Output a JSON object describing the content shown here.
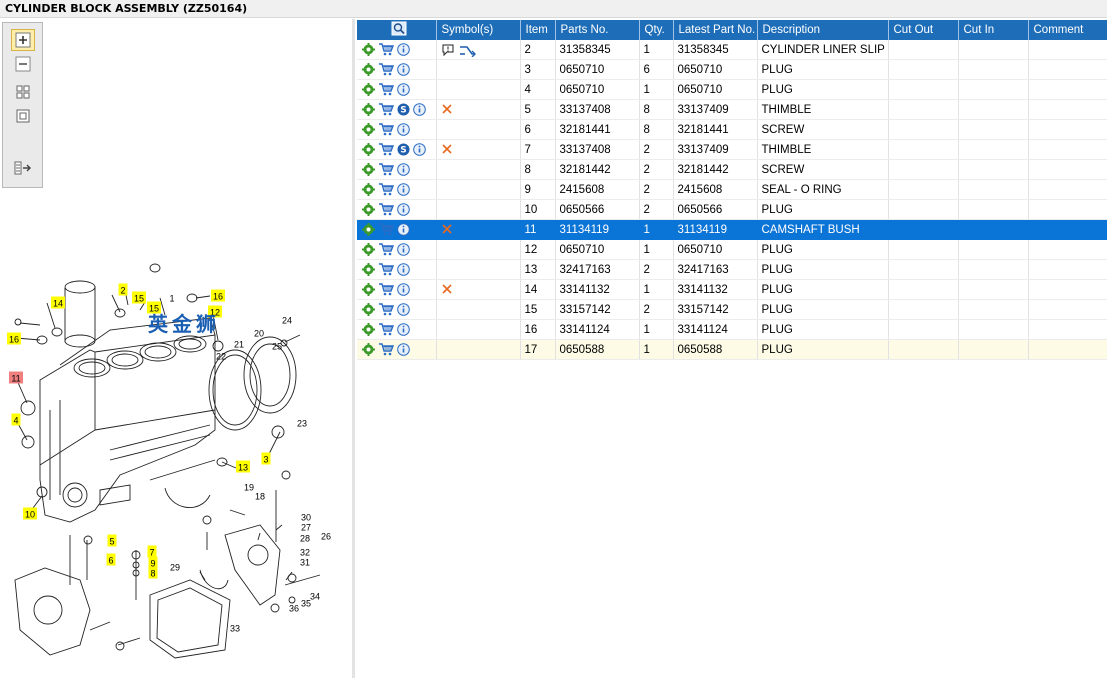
{
  "title": "CYLINDER BLOCK ASSEMBLY (ZZ50164)",
  "toolbar": {
    "items": [
      "zoom-in-icon",
      "zoom-out-icon",
      "tile-view-icon",
      "single-view-icon",
      "export-list-icon"
    ]
  },
  "columns": [
    "",
    "Symbol(s)",
    "Item",
    "Parts No.",
    "Qty.",
    "Latest Part No.",
    "Description",
    "Cut Out",
    "Cut In",
    "Comment"
  ],
  "rows": [
    {
      "item": "2",
      "parts_no": "31358345",
      "qty": "1",
      "latest": "31358345",
      "description": "CYLINDER LINER SLIP FIT",
      "icons": [
        "gear",
        "cart",
        "info"
      ],
      "symbols": [
        "comment",
        "exchange"
      ],
      "state": "normal"
    },
    {
      "item": "3",
      "parts_no": "0650710",
      "qty": "6",
      "latest": "0650710",
      "description": "PLUG",
      "icons": [
        "gear",
        "cart",
        "info"
      ],
      "symbols": [],
      "state": "normal"
    },
    {
      "item": "4",
      "parts_no": "0650710",
      "qty": "1",
      "latest": "0650710",
      "description": "PLUG",
      "icons": [
        "gear",
        "cart",
        "info"
      ],
      "symbols": [],
      "state": "normal"
    },
    {
      "item": "5",
      "parts_no": "33137408",
      "qty": "8",
      "latest": "33137409",
      "description": "THIMBLE",
      "icons": [
        "gear",
        "cart",
        "s",
        "info"
      ],
      "symbols": [
        "cross"
      ],
      "state": "normal"
    },
    {
      "item": "6",
      "parts_no": "32181441",
      "qty": "8",
      "latest": "32181441",
      "description": "SCREW",
      "icons": [
        "gear",
        "cart",
        "info"
      ],
      "symbols": [],
      "state": "normal"
    },
    {
      "item": "7",
      "parts_no": "33137408",
      "qty": "2",
      "latest": "33137409",
      "description": "THIMBLE",
      "icons": [
        "gear",
        "cart",
        "s",
        "info"
      ],
      "symbols": [
        "cross"
      ],
      "state": "normal"
    },
    {
      "item": "8",
      "parts_no": "32181442",
      "qty": "2",
      "latest": "32181442",
      "description": "SCREW",
      "icons": [
        "gear",
        "cart",
        "info"
      ],
      "symbols": [],
      "state": "normal"
    },
    {
      "item": "9",
      "parts_no": "2415608",
      "qty": "2",
      "latest": "2415608",
      "description": "SEAL - O RING",
      "icons": [
        "gear",
        "cart",
        "info"
      ],
      "symbols": [],
      "state": "normal"
    },
    {
      "item": "10",
      "parts_no": "0650566",
      "qty": "2",
      "latest": "0650566",
      "description": "PLUG",
      "icons": [
        "gear",
        "cart",
        "info"
      ],
      "symbols": [],
      "state": "normal"
    },
    {
      "item": "11",
      "parts_no": "31134119",
      "qty": "1",
      "latest": "31134119",
      "description": "CAMSHAFT BUSH",
      "icons": [
        "gear",
        "cart",
        "info"
      ],
      "symbols": [
        "cross"
      ],
      "state": "selected"
    },
    {
      "item": "12",
      "parts_no": "0650710",
      "qty": "1",
      "latest": "0650710",
      "description": "PLUG",
      "icons": [
        "gear",
        "cart",
        "info"
      ],
      "symbols": [],
      "state": "normal"
    },
    {
      "item": "13",
      "parts_no": "32417163",
      "qty": "2",
      "latest": "32417163",
      "description": "PLUG",
      "icons": [
        "gear",
        "cart",
        "info"
      ],
      "symbols": [],
      "state": "normal"
    },
    {
      "item": "14",
      "parts_no": "33141132",
      "qty": "1",
      "latest": "33141132",
      "description": "PLUG",
      "icons": [
        "gear",
        "cart",
        "info"
      ],
      "symbols": [
        "cross"
      ],
      "state": "normal"
    },
    {
      "item": "15",
      "parts_no": "33157142",
      "qty": "2",
      "latest": "33157142",
      "description": "PLUG",
      "icons": [
        "gear",
        "cart",
        "info"
      ],
      "symbols": [],
      "state": "normal"
    },
    {
      "item": "16",
      "parts_no": "33141124",
      "qty": "1",
      "latest": "33141124",
      "description": "PLUG",
      "icons": [
        "gear",
        "cart",
        "info"
      ],
      "symbols": [],
      "state": "normal"
    },
    {
      "item": "17",
      "parts_no": "0650588",
      "qty": "1",
      "latest": "0650588",
      "description": "PLUG",
      "icons": [
        "gear",
        "cart",
        "info"
      ],
      "symbols": [],
      "state": "last"
    }
  ],
  "watermark": "英金狮",
  "callouts": [
    {
      "label": "1",
      "highlight": "none"
    },
    {
      "label": "2",
      "highlight": "yellow"
    },
    {
      "label": "15",
      "highlight": "yellow"
    },
    {
      "label": "15",
      "highlight": "yellow"
    },
    {
      "label": "16",
      "highlight": "yellow"
    },
    {
      "label": "14",
      "highlight": "yellow"
    },
    {
      "label": "12",
      "highlight": "yellow"
    },
    {
      "label": "16",
      "highlight": "yellow"
    },
    {
      "label": "11",
      "highlight": "red"
    },
    {
      "label": "4",
      "highlight": "yellow"
    },
    {
      "label": "10",
      "highlight": "yellow"
    },
    {
      "label": "13",
      "highlight": "yellow"
    },
    {
      "label": "3",
      "highlight": "yellow"
    },
    {
      "label": "5",
      "highlight": "yellow"
    },
    {
      "label": "6",
      "highlight": "yellow"
    },
    {
      "label": "7",
      "highlight": "yellow"
    },
    {
      "label": "9",
      "highlight": "yellow"
    },
    {
      "label": "8",
      "highlight": "yellow"
    },
    {
      "label": "20",
      "highlight": "none"
    },
    {
      "label": "24",
      "highlight": "none"
    },
    {
      "label": "25",
      "highlight": "none"
    },
    {
      "label": "21",
      "highlight": "none"
    },
    {
      "label": "22",
      "highlight": "none"
    },
    {
      "label": "23",
      "highlight": "none"
    },
    {
      "label": "19",
      "highlight": "none"
    },
    {
      "label": "18",
      "highlight": "none"
    },
    {
      "label": "30",
      "highlight": "none"
    },
    {
      "label": "27",
      "highlight": "none"
    },
    {
      "label": "26",
      "highlight": "none"
    },
    {
      "label": "28",
      "highlight": "none"
    },
    {
      "label": "32",
      "highlight": "none"
    },
    {
      "label": "31",
      "highlight": "none"
    },
    {
      "label": "29",
      "highlight": "none"
    },
    {
      "label": "33",
      "highlight": "none"
    },
    {
      "label": "34",
      "highlight": "none"
    },
    {
      "label": "35",
      "highlight": "none"
    },
    {
      "label": "36",
      "highlight": "none"
    }
  ],
  "colors": {
    "header": "#1e6db8",
    "selected": "#0b74d7",
    "highlight": "#ffff00",
    "alert": "#f08080"
  }
}
